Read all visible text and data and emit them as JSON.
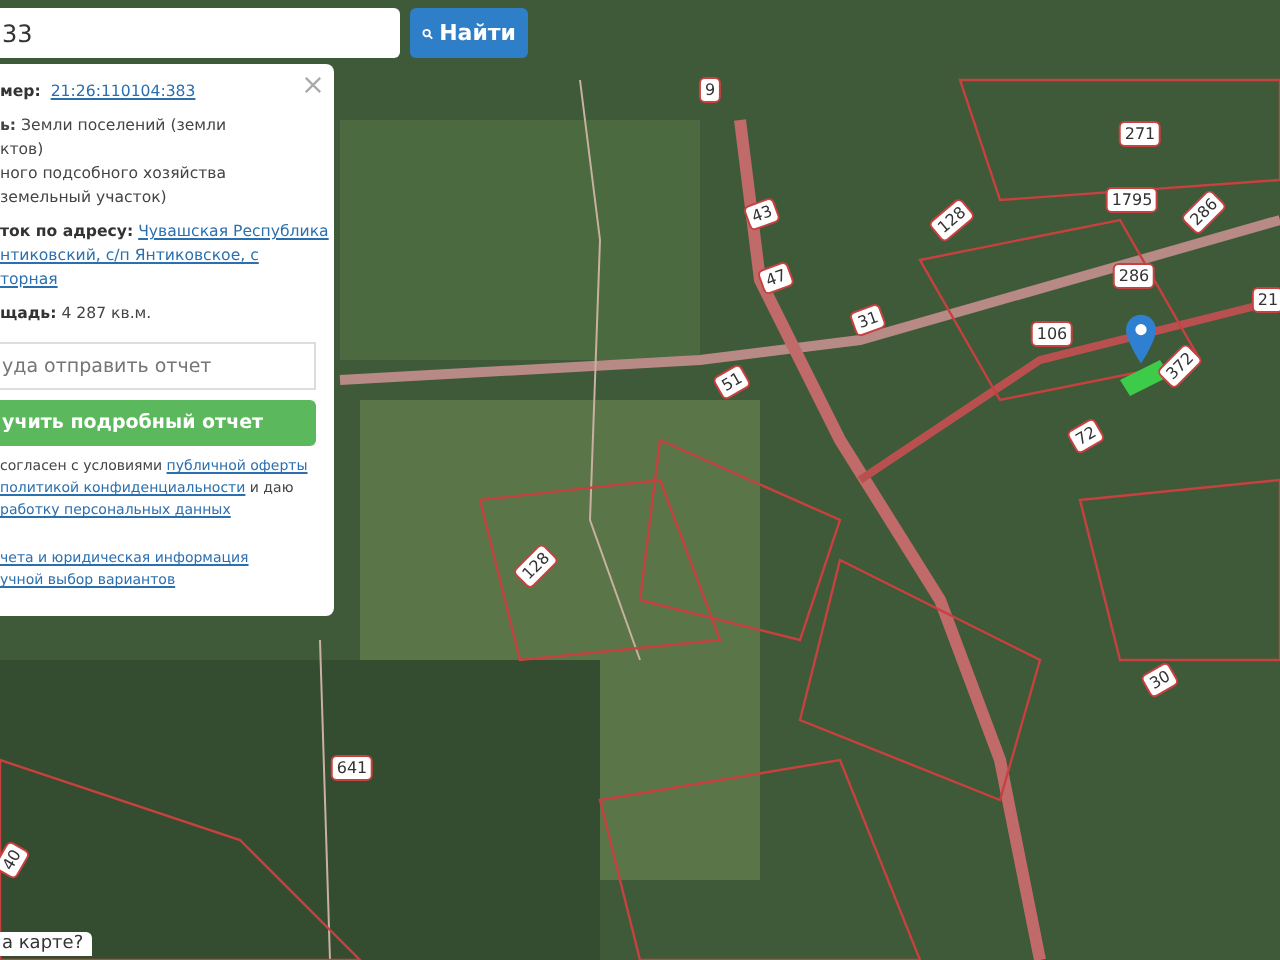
{
  "search": {
    "value": "33",
    "button": "Найти"
  },
  "panel": {
    "cadastral": {
      "label": "мер:",
      "link": "21:26:110104:383"
    },
    "category_lines": [
      "**ь:** Земли поселений (земли",
      "ктов)",
      "ного подсобного хозяйства",
      "земельный участок)"
    ],
    "address": {
      "label": "ток по адресу:",
      "link_lines": [
        "Чувашская Республика",
        "нтиковский, с/п Янтиковское, с",
        "торная"
      ]
    },
    "area": {
      "label": "щадь:",
      "value": "4 287 кв.м."
    },
    "email": {
      "placeholder": "уда отправить отчет"
    },
    "report_button": "учить подробный отчет",
    "consent_lines": [
      [
        {
          "text": "согласен с условиями ",
          "link": false
        },
        {
          "text": "публичной оферты",
          "link": true
        }
      ],
      [
        {
          "text": "политикой конфиденциальности",
          "link": true
        },
        {
          "text": " и даю",
          "link": false
        }
      ],
      [
        {
          "text": "работку персональных данных",
          "link": true
        }
      ]
    ],
    "extra_links": [
      "чета и юридическая информация",
      "учной выбор вариантов"
    ]
  },
  "map_labels": [
    "9",
    "43",
    "47",
    "31",
    "51",
    "128",
    "271",
    "1795",
    "286",
    "286",
    "106",
    "21",
    "372",
    "72",
    "128",
    "641",
    "30",
    "40"
  ],
  "help_text": "а карте?"
}
